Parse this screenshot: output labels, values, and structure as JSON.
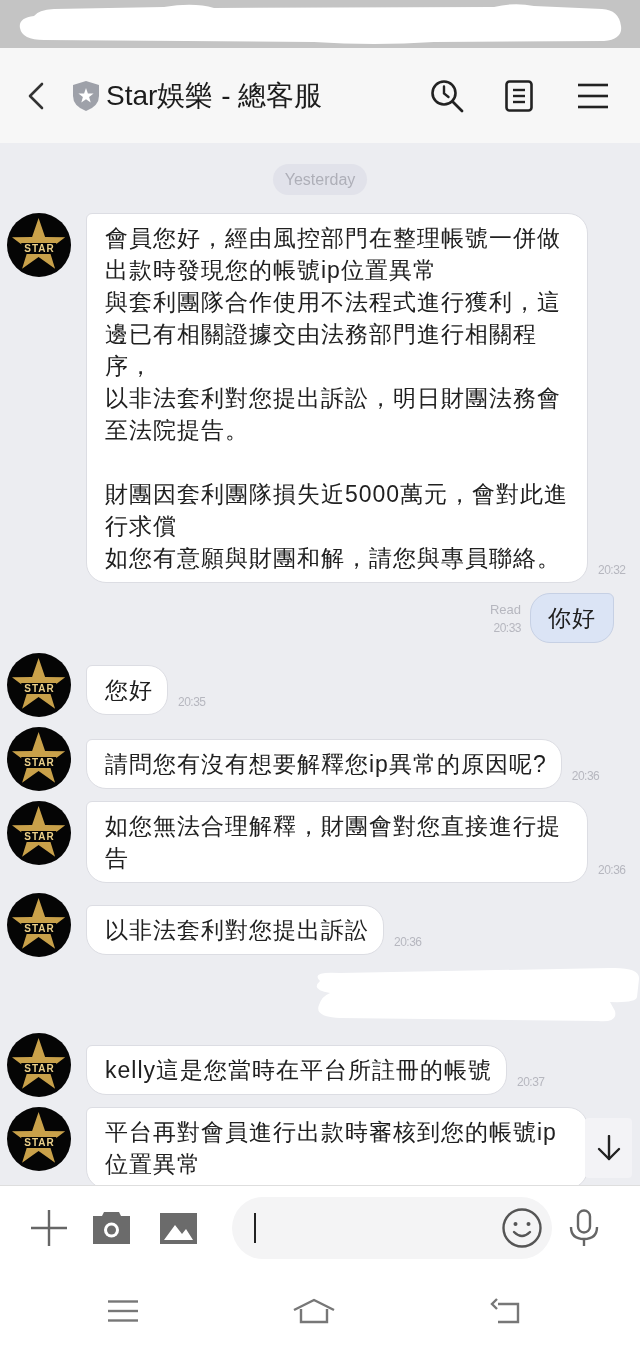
{
  "status_bar": {
    "redacted": true
  },
  "header": {
    "title": "Star娛樂 - 總客服"
  },
  "date_divider": {
    "text": "Yesterday"
  },
  "messages": [
    {
      "kind": "received",
      "avatar_text": "STAR",
      "paragraphs": [
        [
          "會員您好，經由風控部門在整理帳號一併做出款時發現您的帳號ip位置異常",
          "與套利團隊合作使用不法程式進行獲利，這邊已有相關證據交由法務部門進行相關程序，",
          "以非法套利對您提出訴訟，明日財團法務會至法院提告。"
        ],
        [
          "財團因套利團隊損失近5000萬元，會對此進行求償",
          "如您有意願與財團和解，請您與專員聯絡。"
        ]
      ],
      "time": "20:32"
    },
    {
      "kind": "sent",
      "text": "你好",
      "status": "Read",
      "time": "20:33"
    },
    {
      "kind": "received",
      "avatar_text": "STAR",
      "text": "您好",
      "time": "20:35"
    },
    {
      "kind": "received",
      "avatar_text": "STAR",
      "text": "請問您有沒有想要解釋您ip異常的原因呢?",
      "time": "20:36"
    },
    {
      "kind": "received",
      "avatar_text": "STAR",
      "text": "如您無法合理解釋，財團會對您直接進行提告",
      "time": "20:36"
    },
    {
      "kind": "received",
      "avatar_text": "STAR",
      "text": "以非法套利對您提出訴訟",
      "time": "20:36"
    },
    {
      "kind": "redacted"
    },
    {
      "kind": "received",
      "avatar_text": "STAR",
      "text": "kelly這是您當時在平台所註冊的帳號",
      "time": "20:37"
    },
    {
      "kind": "received",
      "avatar_text": "STAR",
      "text": "平台再對會員進行出款時審核到您的帳號ip位置異常"
    }
  ]
}
